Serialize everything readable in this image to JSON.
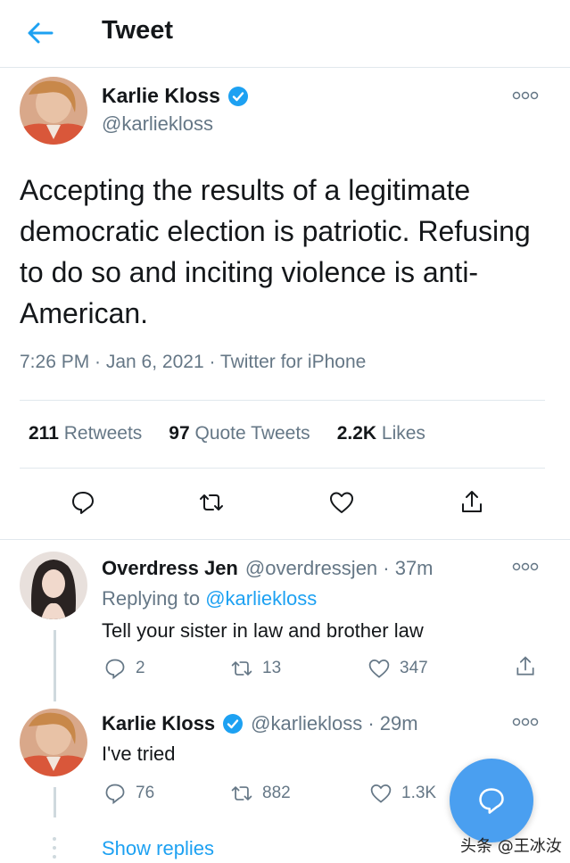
{
  "header": {
    "title": "Tweet"
  },
  "tweet": {
    "name": "Karlie Kloss",
    "handle": "@karliekloss",
    "text": "Accepting the results of a legitimate democratic election is patriotic. Refusing to do so and inciting violence is anti-American.",
    "meta": "7:26 PM · Jan 6, 2021 · Twitter for iPhone",
    "stats": {
      "retweets_count": "211",
      "retweets_label": "Retweets",
      "quotes_count": "97",
      "quotes_label": "Quote Tweets",
      "likes_count": "2.2K",
      "likes_label": "Likes"
    }
  },
  "replies": [
    {
      "name": "Overdress Jen",
      "handle_time": "@overdressjen · 37m",
      "replying_prefix": "Replying to",
      "replying_to": "@karliekloss",
      "text": "Tell your sister in law and brother law",
      "reply_count": "2",
      "retweet_count": "13",
      "like_count": "347"
    },
    {
      "name": "Karlie Kloss",
      "handle_time": "@karliekloss · 29m",
      "text": "I've tried",
      "reply_count": "76",
      "retweet_count": "882",
      "like_count": "1.3K"
    }
  ],
  "show_replies": "Show replies",
  "watermark": "头条 @王冰汝",
  "colors": {
    "accent": "#1da1f2",
    "fab": "#4a9ff0",
    "muted": "#657786"
  }
}
